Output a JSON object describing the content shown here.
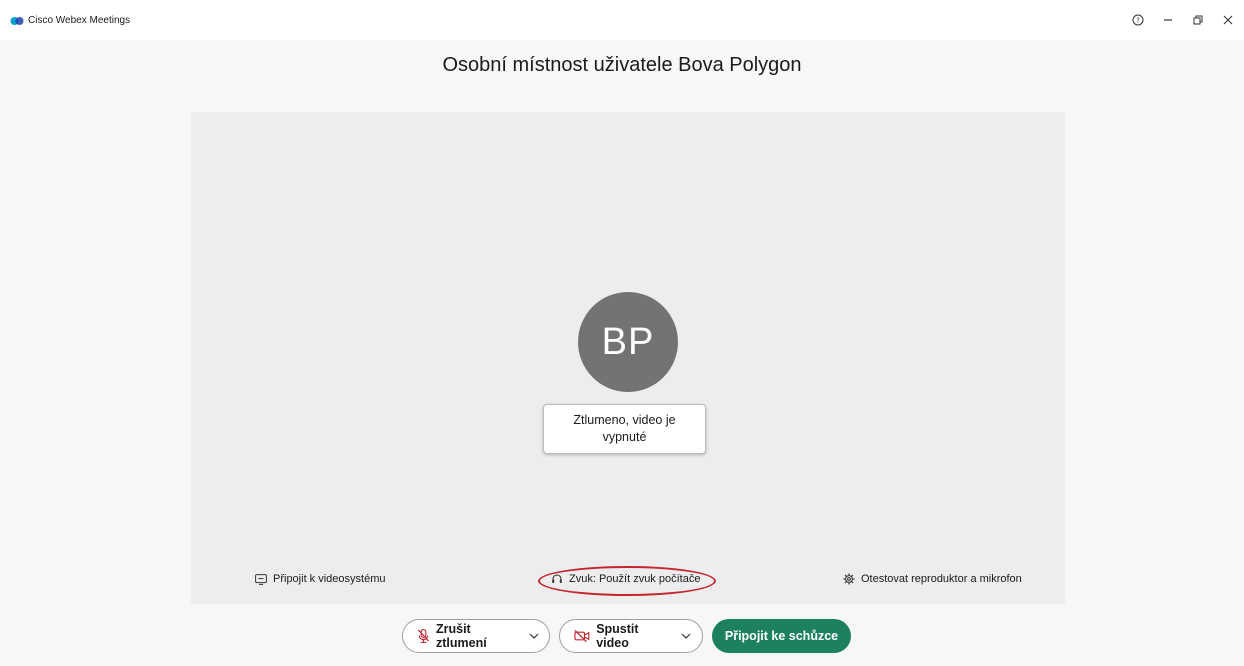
{
  "app": {
    "title": "Cisco Webex Meetings"
  },
  "room": {
    "title": "Osobní místnost uživatele Bova Polygon"
  },
  "preview": {
    "avatar_initials": "BP",
    "status_text": "Ztlumeno, video je vypnuté"
  },
  "links": {
    "video_system": "Připojit k videosystému",
    "audio": "Zvuk: Použít zvuk počítače",
    "test_audio": "Otestovat reproduktor a mikrofon"
  },
  "controls": {
    "unmute_label": "Zrušit ztlumení",
    "video_label": "Spustit video",
    "join_label": "Připojit ke schůzce"
  },
  "colors": {
    "join_button": "#1d8160",
    "avatar_bg": "#737373",
    "highlight_ring": "#c4252f",
    "muted_icon": "#c4252f"
  },
  "icons": {
    "logo": "webex-logo-icon",
    "help": "help-icon",
    "minimize": "minimize-icon",
    "restore": "restore-icon",
    "close": "close-icon",
    "video_system": "video-system-icon",
    "audio": "headset-icon",
    "test_audio": "gear-icon",
    "unmute": "microphone-muted-icon",
    "video": "camera-off-icon",
    "chevron": "chevron-down-icon"
  }
}
